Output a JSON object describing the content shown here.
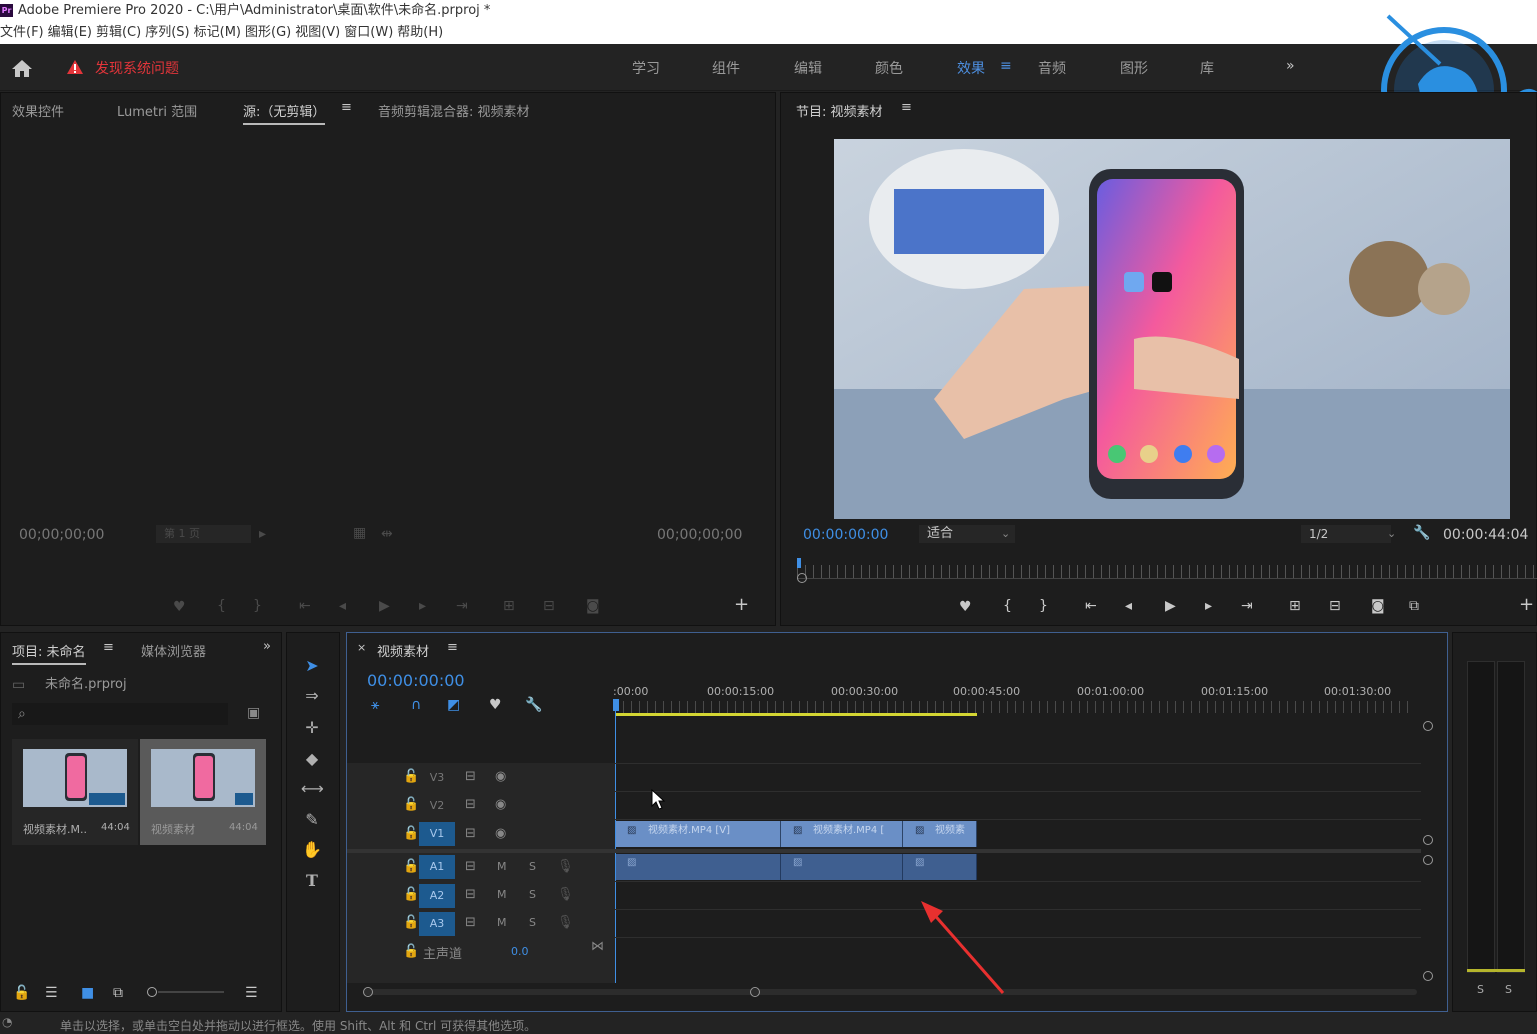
{
  "titlebar": {
    "logo": "Pr",
    "title": "Adobe Premiere Pro 2020 - C:\\用户\\Administrator\\桌面\\软件\\未命名.prproj *"
  },
  "menu": [
    "文件(F)",
    "编辑(E)",
    "剪辑(C)",
    "序列(S)",
    "标记(M)",
    "图形(G)",
    "视图(V)",
    "窗口(W)",
    "帮助(H)"
  ],
  "header": {
    "alert": "发现系统问题",
    "workspaces": [
      "学习",
      "组件",
      "编辑",
      "颜色",
      "效果",
      "音频",
      "图形",
      "库"
    ],
    "active_workspace": "效果",
    "more": "»"
  },
  "source_panel": {
    "tabs": [
      "效果控件",
      "Lumetri 范围",
      "源:（无剪辑）",
      "音频剪辑混合器: 视频素材"
    ],
    "timecode_left": "00;00;00;00",
    "timecode_right": "00;00;00;00",
    "page_select": "第 1 页"
  },
  "program_panel": {
    "title": "节目: 视频素材",
    "timecode": "00:00:00:00",
    "fit": "适合",
    "resolution": "1/2",
    "duration": "00:00:44:04"
  },
  "project_panel": {
    "tab": "项目: 未命名",
    "tab2": "媒体浏览器",
    "file": "未命名.prproj",
    "items": [
      {
        "name": "视频素材.M..",
        "dur": "44:04"
      },
      {
        "name": "视频素材",
        "dur": "44:04"
      }
    ]
  },
  "timeline": {
    "title": "视频素材",
    "timecode": "00:00:00:00",
    "ruler": [
      ":00:00",
      "00:00:15:00",
      "00:00:30:00",
      "00:00:45:00",
      "00:01:00:00",
      "00:01:15:00",
      "00:01:30:00"
    ],
    "video_tracks": [
      "V3",
      "V2",
      "V1"
    ],
    "audio_tracks": [
      "A1",
      "A2",
      "A3"
    ],
    "master": "主声道",
    "master_value": "0.0",
    "clips": [
      "视频素材.MP4 [V]",
      "视频素材.MP4 [",
      "视频素"
    ],
    "m": "M",
    "s": "S"
  },
  "meters": {
    "s1": "S",
    "s2": "S"
  },
  "status_bar": "单击以选择，或单击空白处并拖动以进行框选。使用 Shift、Alt 和 Ctrl 可获得其他选项。"
}
